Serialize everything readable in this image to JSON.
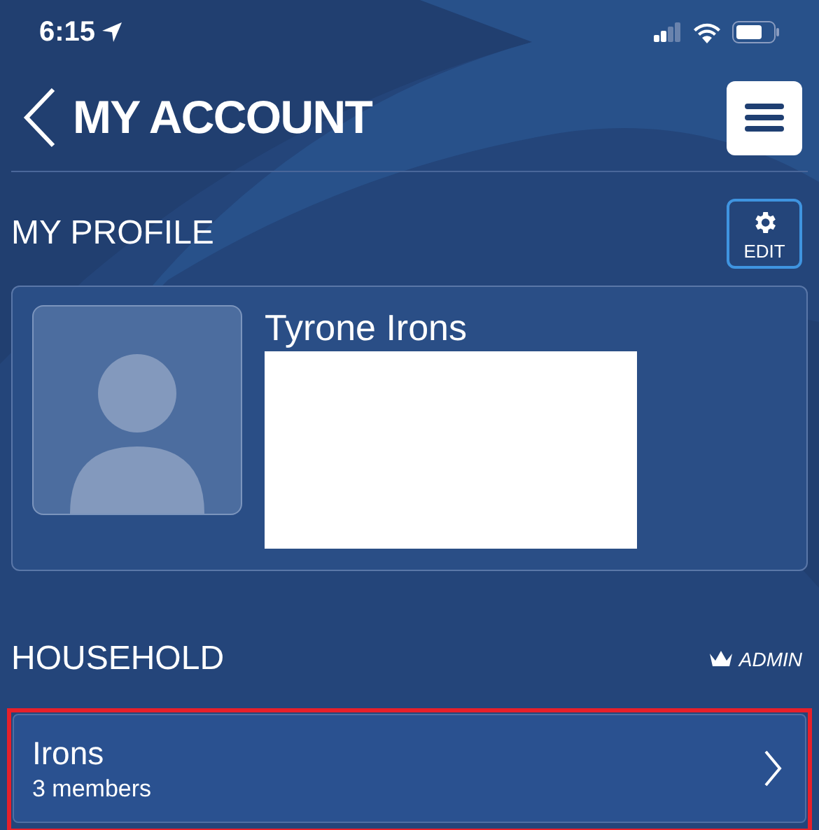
{
  "status_bar": {
    "time": "6:15"
  },
  "header": {
    "title": "MY ACCOUNT"
  },
  "profile": {
    "heading": "MY PROFILE",
    "edit_label": "EDIT",
    "name": "Tyrone Irons"
  },
  "household": {
    "heading": "HOUSEHOLD",
    "role": "ADMIN",
    "items": [
      {
        "name": "Irons",
        "members": "3 members",
        "highlighted": true
      }
    ]
  }
}
